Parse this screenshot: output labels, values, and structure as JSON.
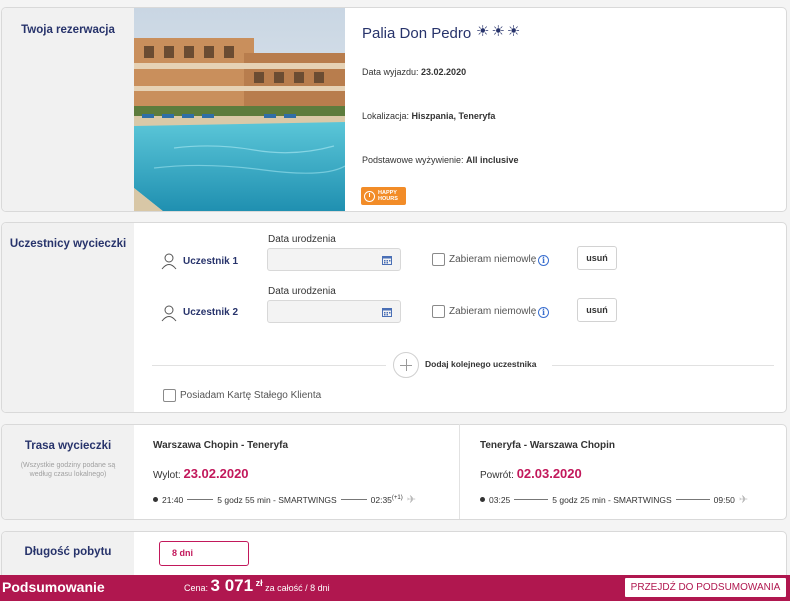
{
  "reservation": {
    "section_title": "Twoja rezerwacja",
    "hotel_name": "Palia Don Pedro",
    "sun_rating": "☀☀☀",
    "departure_label": "Data wyjazdu: ",
    "departure_value": "23.02.2020",
    "location_label": "Lokalizacja: ",
    "location_value": "Hiszpania, Teneryfa",
    "board_label": "Podstawowe wyżywienie: ",
    "board_value": "All inclusive",
    "badge_line1": "HAPPY",
    "badge_line2": "HOURS",
    "badge_color": "#f28c28"
  },
  "participants": {
    "section_title": "Uczestnicy wycieczki",
    "items": [
      {
        "label": "Uczestnik 1",
        "dob_label": "Data urodzenia",
        "dob_value": "",
        "infant_label": "Zabieram niemowlę",
        "remove_label": "usuń"
      },
      {
        "label": "Uczestnik 2",
        "dob_label": "Data urodzenia",
        "dob_value": "",
        "infant_label": "Zabieram niemowlę",
        "remove_label": "usuń"
      }
    ],
    "add_label": "Dodaj kolejnego uczestnika",
    "loyalty_label": "Posiadam Kartę Stałego Klienta"
  },
  "route": {
    "section_title": "Trasa wycieczki",
    "section_note": "(Wszystkie godziny podane są według czasu lokalnego)",
    "outbound": {
      "title": "Warszawa Chopin - Teneryfa",
      "date_label": "Wylot: ",
      "date": "23.02.2020",
      "dep_time": "21:40",
      "duration": "5 godz 55 min - SMARTWINGS",
      "arr_time": "02:35",
      "arr_offset": "(+1)"
    },
    "return": {
      "title": "Teneryfa - Warszawa Chopin",
      "date_label": "Powrót: ",
      "date": "02.03.2020",
      "dep_time": "03:25",
      "duration": "5 godz 25 min - SMARTWINGS",
      "arr_time": "09:50"
    }
  },
  "stay": {
    "section_title": "Długość pobytu",
    "value": "8 dni"
  },
  "summary": {
    "title": "Podsumowanie",
    "price_label": "Cena: ",
    "price_amount": "3 071",
    "currency": "zł",
    "price_note": "za całość / 8 dni",
    "proceed_label": "PRZEJDŹ DO PODSUMOWANIA"
  },
  "colors": {
    "accent": "#b0174f",
    "navy": "#27336b",
    "badge": "#f28c28"
  }
}
